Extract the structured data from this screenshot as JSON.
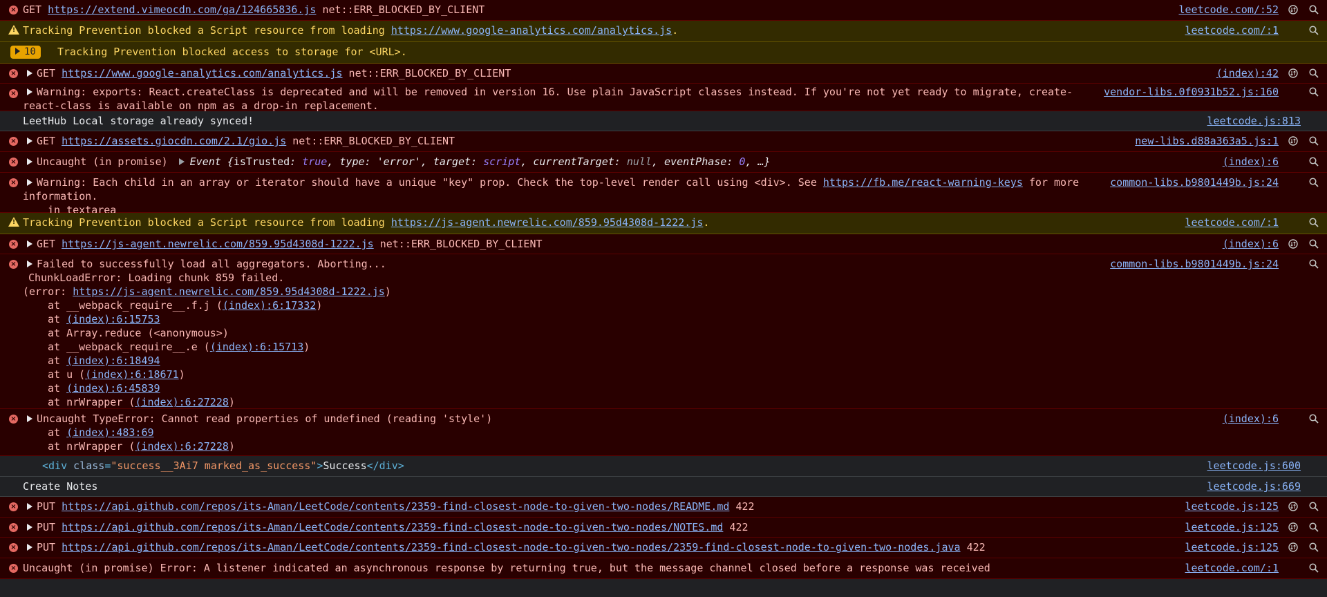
{
  "colors": {
    "error_bg": "#290000",
    "warning_bg": "#332b00",
    "link": "#8ab4f8",
    "error_text": "#f9b8b4",
    "warning_text": "#fdd663",
    "badge": "#e7a300"
  },
  "rows": [
    {
      "prefix": "GET ",
      "url": "https://extend.vimeocdn.com/ga/124665836.js",
      "suffix": " net::ERR_BLOCKED_BY_CLIENT",
      "source": "leetcode.com/:52"
    },
    {
      "prefix": "Tracking Prevention blocked a Script resource from loading ",
      "url": "https://www.google-analytics.com/analytics.js",
      "suffix": ".",
      "source": "leetcode.com/:1"
    },
    {
      "badge": "10",
      "text": "Tracking Prevention blocked access to storage for <URL>."
    },
    {
      "prefix": "GET ",
      "url": "https://www.google-analytics.com/analytics.js",
      "suffix": " net::ERR_BLOCKED_BY_CLIENT",
      "source": "(index):42"
    },
    {
      "text": "Warning: exports: React.createClass is deprecated and will be removed in version 16. Use plain JavaScript classes instead. If you're not yet ready to migrate, create-react-class is available on npm as a drop-in replacement.",
      "source": "vendor-libs.0f0931b52.js:160"
    },
    {
      "text": "LeetHub Local storage already synced!",
      "source": "leetcode.js:813"
    },
    {
      "prefix": "GET ",
      "url": "https://assets.giocdn.com/2.1/gio.js",
      "suffix": " net::ERR_BLOCKED_BY_CLIENT",
      "source": "new-libs.d88a363a5.js:1"
    },
    {
      "text": "Uncaught (in promise)",
      "event_label": "Event",
      "event_open": " {",
      "k1": "isTrusted",
      "v1": "true",
      "k2": "type",
      "v2": "'error'",
      "k3": "target",
      "v3": "script",
      "k4": "currentTarget",
      "v4": "null",
      "k5": "eventPhase",
      "v5": "0",
      "event_tail": ", …}",
      "source": "(index):6"
    },
    {
      "prefix": "Warning: Each child in an array or iterator should have a unique \"key\" prop. Check the top-level render call using <div>. See ",
      "url": "https://fb.me/react-warning-keys",
      "suffix": " for more information.",
      "line2": "in textarea",
      "source": "common-libs.b9801449b.js:24"
    },
    {
      "prefix": "Tracking Prevention blocked a Script resource from loading ",
      "url": "https://js-agent.newrelic.com/859.95d4308d-1222.js",
      "suffix": ".",
      "source": "leetcode.com/:1"
    },
    {
      "prefix": "GET ",
      "url": "https://js-agent.newrelic.com/859.95d4308d-1222.js",
      "suffix": " net::ERR_BLOCKED_BY_CLIENT",
      "source": "(index):6"
    },
    {
      "text": "Failed to successfully load all aggregators. Aborting...",
      "line2": "ChunkLoadError: Loading chunk 859 failed.",
      "line3_prefix": "(error: ",
      "line3_url": "https://js-agent.newrelic.com/859.95d4308d-1222.js",
      "line3_suffix": ")",
      "stack": [
        {
          "pre": "at __webpack_require__.f.j (",
          "link": "(index):6:17332",
          "post": ")"
        },
        {
          "pre": "at ",
          "link": "(index):6:15753",
          "post": ""
        },
        {
          "pre": "at Array.reduce (<anonymous>)",
          "link": "",
          "post": ""
        },
        {
          "pre": "at __webpack_require__.e (",
          "link": "(index):6:15713",
          "post": ")"
        },
        {
          "pre": "at ",
          "link": "(index):6:18494",
          "post": ""
        },
        {
          "pre": "at u (",
          "link": "(index):6:18671",
          "post": ")"
        },
        {
          "pre": "at ",
          "link": "(index):6:45839",
          "post": ""
        },
        {
          "pre": "at nrWrapper (",
          "link": "(index):6:27228",
          "post": ")"
        }
      ],
      "source": "common-libs.b9801449b.js:24"
    },
    {
      "text": "Uncaught TypeError: Cannot read properties of undefined (reading 'style')",
      "stack": [
        {
          "pre": "at ",
          "link": "(index):483:69",
          "post": ""
        },
        {
          "pre": "at nrWrapper (",
          "link": "(index):6:27228",
          "post": ")"
        }
      ],
      "source": "(index):6"
    },
    {
      "tag_open": "<div",
      "attr1": "class",
      "val1": "\"success__3Ai7 marked_as_success\"",
      "gt": ">",
      "content": "Success",
      "tag_close": "</div>",
      "source": "leetcode.js:600"
    },
    {
      "text": "Create Notes",
      "source": "leetcode.js:669"
    },
    {
      "prefix": "PUT ",
      "url": "https://api.github.com/repos/its-Aman/LeetCode/contents/2359-find-closest-node-to-given-two-nodes/README.md",
      "suffix": " 422",
      "source": "leetcode.js:125"
    },
    {
      "prefix": "PUT ",
      "url": "https://api.github.com/repos/its-Aman/LeetCode/contents/2359-find-closest-node-to-given-two-nodes/NOTES.md",
      "suffix": " 422",
      "source": "leetcode.js:125"
    },
    {
      "prefix": "PUT ",
      "url": "https://api.github.com/repos/its-Aman/LeetCode/contents/2359-find-closest-node-to-given-two-nodes/2359-find-closest-node-to-given-two-nodes.java",
      "suffix": " 422",
      "source": "leetcode.js:125"
    },
    {
      "text": "Uncaught (in promise) Error: A listener indicated an asynchronous response by returning true, but the message channel closed before a response was received",
      "source": "leetcode.com/:1"
    }
  ],
  "icons": {
    "error": "error-circle-icon",
    "warning": "warning-triangle-icon",
    "expand": "expand-arrow-icon",
    "network_info": "network-info-icon",
    "search": "magnifier-icon"
  }
}
